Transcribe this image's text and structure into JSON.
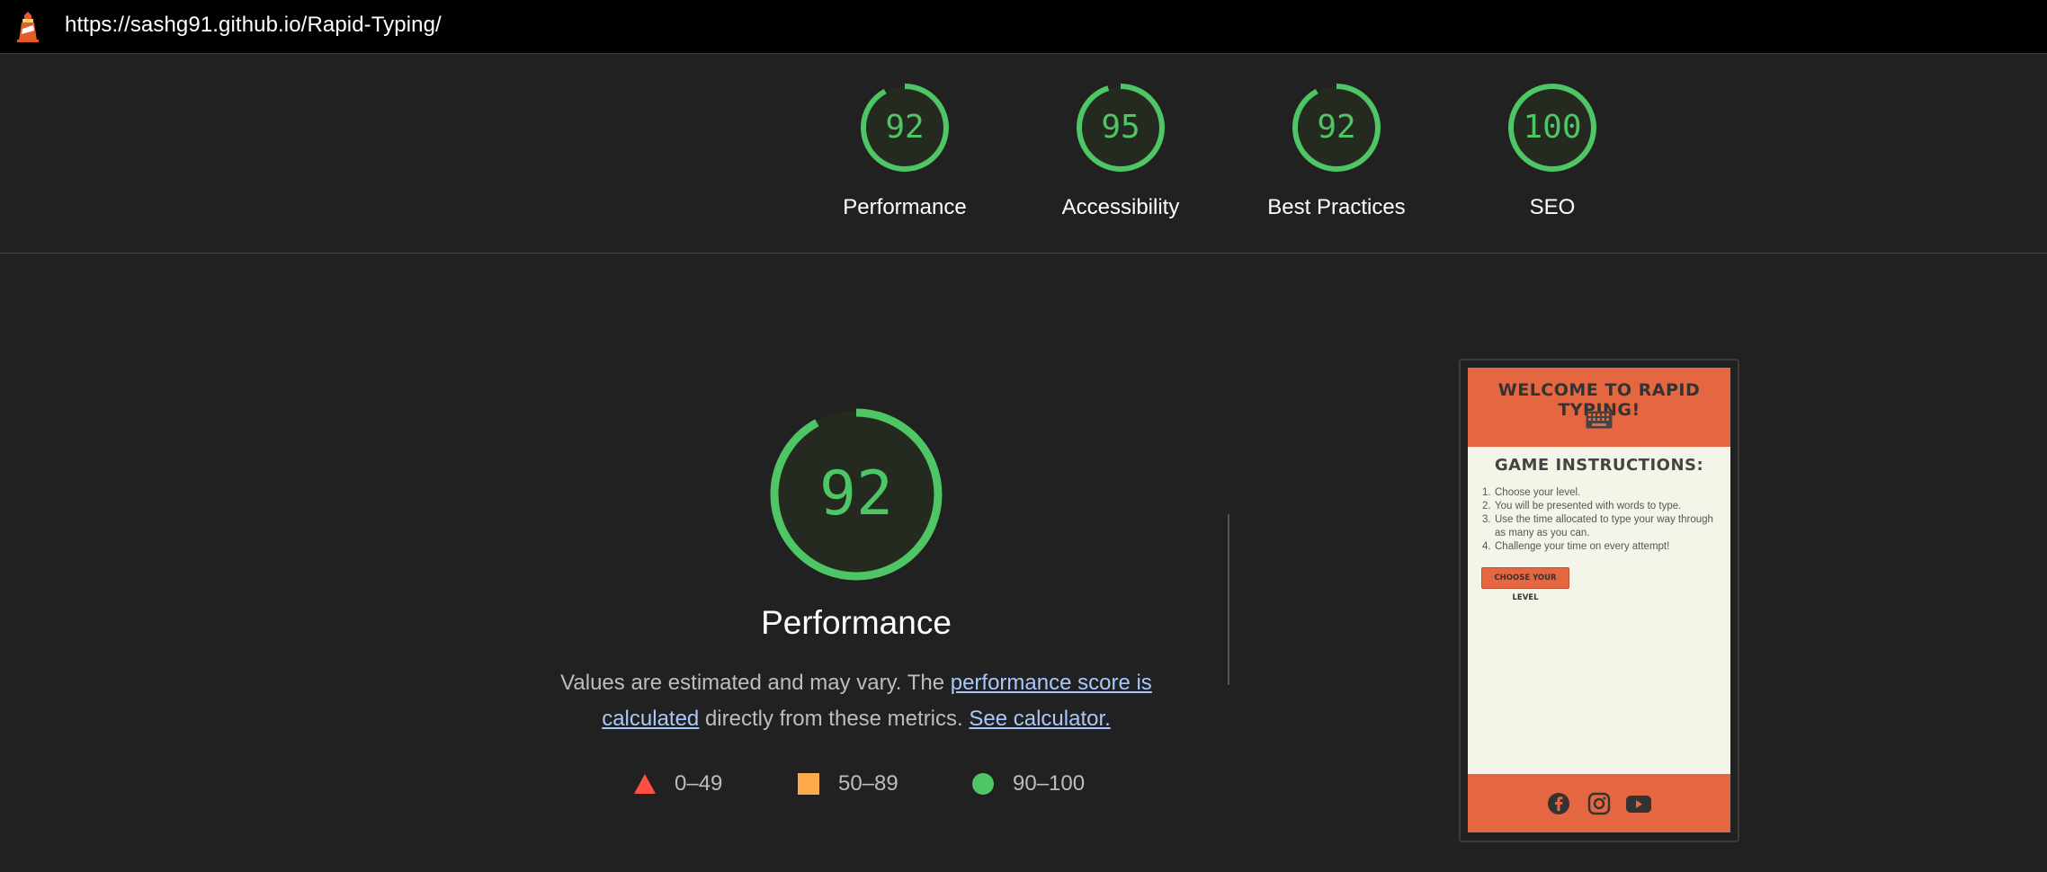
{
  "browser": {
    "url": "https://sashg91.github.io/Rapid-Typing/"
  },
  "colors": {
    "pass": "#4fc666",
    "average": "#ffa400",
    "fail": "#ff4e42",
    "background": "#212121"
  },
  "categories": [
    {
      "score": "92",
      "label": "Performance",
      "fraction": 0.92
    },
    {
      "score": "95",
      "label": "Accessibility",
      "fraction": 0.95
    },
    {
      "score": "92",
      "label": "Best Practices",
      "fraction": 0.92
    },
    {
      "score": "100",
      "label": "SEO",
      "fraction": 1.0
    }
  ],
  "performance": {
    "score": "92",
    "fraction": 0.92,
    "title": "Performance",
    "desc_prefix": "Values are estimated and may vary. The ",
    "desc_link": "performance score is calculated",
    "desc_mid": " directly from these metrics. ",
    "calc_link": "See calculator."
  },
  "legend": [
    {
      "icon": "triangle-icon",
      "range": "0–49"
    },
    {
      "icon": "square-icon",
      "range": "50–89"
    },
    {
      "icon": "circle-icon",
      "range": "90–100"
    }
  ],
  "screenshot": {
    "title": "WELCOME TO RAPID TYPING!",
    "instructions_title": "GAME INSTRUCTIONS:",
    "steps": [
      {
        "n": "1.",
        "text": "Choose your level."
      },
      {
        "n": "2.",
        "text": "You will be presented with words to type."
      },
      {
        "n": "3.",
        "text": "Use the time allocated to type your way through as many as you can."
      },
      {
        "n": "4.",
        "text": "Challenge your time on every attempt!"
      }
    ],
    "button": "CHOOSE YOUR LEVEL",
    "social_icons": [
      "facebook-icon",
      "instagram-icon",
      "youtube-icon"
    ]
  }
}
